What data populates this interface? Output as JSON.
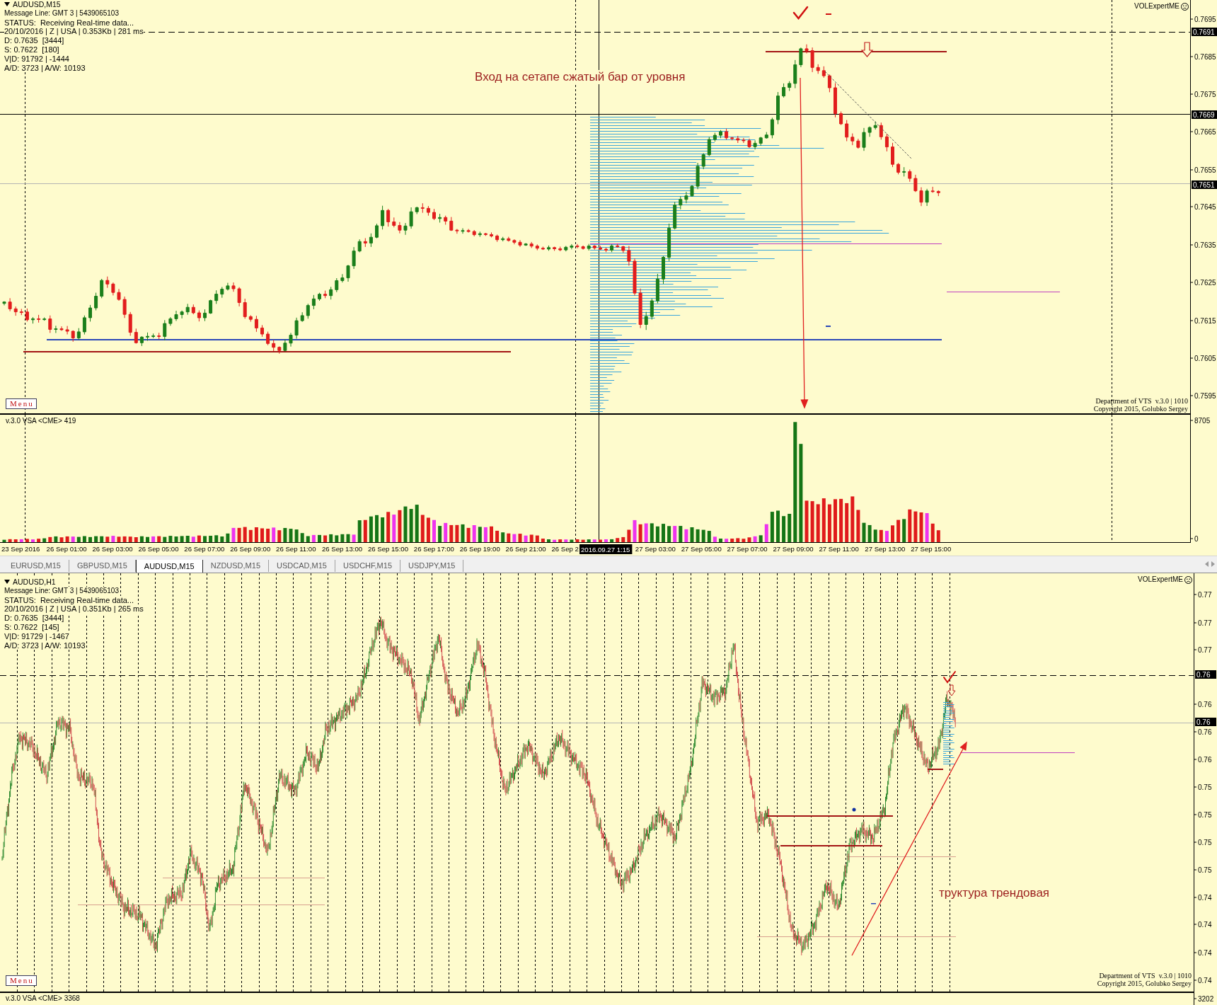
{
  "top_window": {
    "chart": {
      "symbol": "AUDUSD,M15",
      "info_lines": [
        "Message Line: GMT 3 | 5439065103",
        "STATUS:  Receiving Real-time data...",
        "20/10/2016 | Z | USA | 0.353Kb | 281 ms",
        "D: 0.7635  [3444]",
        "S: 0.7622  [180]",
        "V|D: 91792 | -1444",
        "A/D: 3723 | A/W: 10193"
      ],
      "expert_label": "VOLExpertME",
      "annotation": "Вход на сетапе сжатый бар от уровня",
      "menu_button": "Menu",
      "credits": [
        "Department of VTS  v.3.0 | 1010",
        "Copyright 2015, Golubko Sergey"
      ]
    },
    "price_axis": [
      {
        "kind": "tick",
        "text": "0.7695"
      },
      {
        "kind": "marker",
        "text": "0.7691"
      },
      {
        "kind": "tick",
        "text": "0.7685"
      },
      {
        "kind": "tick",
        "text": "0.7675"
      },
      {
        "kind": "marker",
        "text": "0.7669"
      },
      {
        "kind": "tick",
        "text": "0.7665"
      },
      {
        "kind": "tick",
        "text": "0.7655"
      },
      {
        "kind": "marker",
        "text": "0.7651"
      },
      {
        "kind": "tick",
        "text": "0.7645"
      },
      {
        "kind": "tick",
        "text": "0.7635"
      },
      {
        "kind": "tick",
        "text": "0.7625"
      },
      {
        "kind": "tick",
        "text": "0.7615"
      },
      {
        "kind": "tick",
        "text": "0.7605"
      },
      {
        "kind": "tick",
        "text": "0.7595"
      }
    ],
    "volume_panel": {
      "title": "v.3.0 VSA <CME> 419",
      "scale": [
        "8705",
        "0"
      ]
    },
    "time_axis": {
      "labels": [
        "23 Sep 2016",
        "26 Sep 01:00",
        "26 Sep 03:00",
        "26 Sep 05:00",
        "26 Sep 07:00",
        "26 Sep 09:00",
        "26 Sep 11:00",
        "26 Sep 13:00",
        "26 Sep 15:00",
        "26 Sep 17:00",
        "26 Sep 19:00",
        "26 Sep 21:00",
        "26 Sep 2",
        "27 Sep 03:00",
        "27 Sep 05:00",
        "27 Sep 07:00",
        "27 Sep 09:00",
        "27 Sep 11:00",
        "27 Sep 13:00",
        "27 Sep 15:00"
      ],
      "cursor_label": "2016.09.27 1:15"
    }
  },
  "tabs": [
    {
      "label": "EURUSD,M15",
      "selected": false
    },
    {
      "label": "GBPUSD,M15",
      "selected": false
    },
    {
      "label": "AUDUSD,M15",
      "selected": true
    },
    {
      "label": "NZDUSD,M15",
      "selected": false
    },
    {
      "label": "USDCAD,M15",
      "selected": false
    },
    {
      "label": "USDCHF,M15",
      "selected": false
    },
    {
      "label": "USDJPY,M15",
      "selected": false
    }
  ],
  "bottom_window": {
    "chart": {
      "symbol": "AUDUSD,H1",
      "info_lines": [
        "Message Line: GMT 3 | 5439065103",
        "STATUS:  Receiving Real-time data...",
        "20/10/2016 | Z | USA | 0.351Kb | 265 ms",
        "D: 0.7635  [3444]",
        "S: 0.7622  [145]",
        "V|D: 91729 | -1467",
        "A/D: 3723 | A/W: 10193"
      ],
      "expert_label": "VOLExpertME",
      "annotation": "труктура трендовая",
      "menu_button": "Menu",
      "credits": [
        "Department of VTS  v.3.0 | 1010",
        "Copyright 2015, Golubko Sergey"
      ]
    },
    "price_axis": [
      {
        "kind": "tick",
        "text": "0.77"
      },
      {
        "kind": "tick",
        "text": "0.77"
      },
      {
        "kind": "tick",
        "text": "0.77"
      },
      {
        "kind": "marker",
        "text": "0.76"
      },
      {
        "kind": "tick",
        "text": "0.76"
      },
      {
        "kind": "marker",
        "text": "0.76"
      },
      {
        "kind": "tick",
        "text": "0.76"
      },
      {
        "kind": "tick",
        "text": "0.76"
      },
      {
        "kind": "tick",
        "text": "0.75"
      },
      {
        "kind": "tick",
        "text": "0.75"
      },
      {
        "kind": "tick",
        "text": "0.75"
      },
      {
        "kind": "tick",
        "text": "0.75"
      },
      {
        "kind": "tick",
        "text": "0.74"
      },
      {
        "kind": "tick",
        "text": "0.74"
      },
      {
        "kind": "tick",
        "text": "0.74"
      },
      {
        "kind": "tick",
        "text": "0.74"
      }
    ],
    "volume_panel": {
      "title": "v.3.0 VSA <CME> 3368",
      "scale": [
        "3202"
      ]
    }
  }
}
